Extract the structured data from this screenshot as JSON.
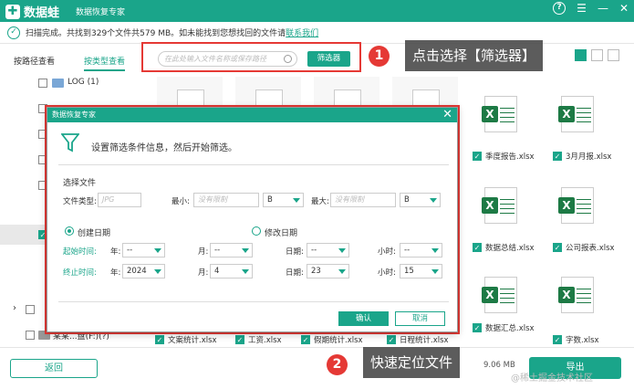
{
  "app": {
    "name": "数据蛙",
    "subtitle": "数据恢复专家",
    "logo_glyph": "✚"
  },
  "status": {
    "text": "扫描完成。共找到329个文件共579 MB。如未能找到您想找回的文件请",
    "link": "联系我们"
  },
  "tabs": [
    {
      "label": "按路径查看"
    },
    {
      "label": "按类型查看"
    }
  ],
  "search": {
    "placeholder": "在此处输入文件名称或保存路径"
  },
  "filter_button": "筛选器",
  "tree": {
    "log_item": "LOG (1)",
    "bottom_item": "某某...盘(F:)(?)"
  },
  "thumbnails": [
    {
      "name": "季度报告.xlsx"
    },
    {
      "name": "3月月报.xlsx"
    },
    {
      "name": "数据总结.xlsx"
    },
    {
      "name": "公司报表.xlsx"
    },
    {
      "name": "数据汇总.xlsx"
    },
    {
      "name": "字数.xlsx"
    }
  ],
  "bottom_files": [
    "文案统计.xlsx",
    "工资.xlsx",
    "假期统计.xlsx",
    "日程统计.xlsx"
  ],
  "dialog": {
    "title": "数据恢复专家",
    "hint": "设置筛选条件信息，然后开始筛选。",
    "section": "选择文件",
    "file_type_label": "文件类型:",
    "file_type_placeholder": "JPG",
    "min_label": "最小:",
    "max_label": "最大:",
    "size_placeholder": "没有限制",
    "unit": "B",
    "created_label": "创建日期",
    "modified_label": "修改日期",
    "start_label": "起始时间:",
    "end_label": "终止时间:",
    "year_label": "年:",
    "month_label": "月:",
    "day_label": "日期:",
    "hour_label": "小时:",
    "dash": "--",
    "end_year": "2024",
    "end_month": "4",
    "end_day": "23",
    "end_hour": "15",
    "ok": "确认",
    "cancel": "取消"
  },
  "callouts": [
    {
      "num": "1",
      "text": "点击选择【筛选器】"
    },
    {
      "num": "2",
      "text": "快速定位文件"
    }
  ],
  "bottom": {
    "back": "返回",
    "export": "导出",
    "size": "9.06 MB"
  },
  "watermark": "@稀土掘金技术社区",
  "colors": {
    "accent": "#1aa58a",
    "highlight": "#e53935",
    "excel": "#1d7a45"
  }
}
